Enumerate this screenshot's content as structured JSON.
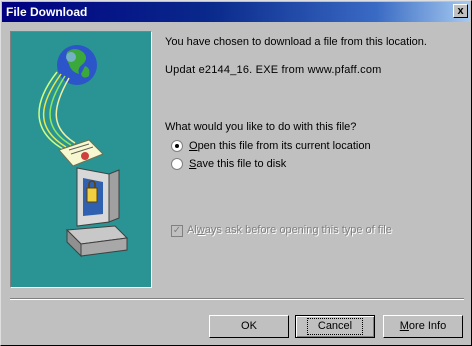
{
  "window": {
    "title": "File Download",
    "close_glyph": "x"
  },
  "message": {
    "line1": "You have chosen to download a file from this location.",
    "filename": "Updat e2144_16. EXE from www.pfaff.com",
    "question": "What would you like to do with this file?"
  },
  "options": {
    "open": {
      "accel": "O",
      "rest": "pen this file from its current location",
      "selected": true
    },
    "save": {
      "accel": "S",
      "rest": "ave this file to disk",
      "selected": false
    }
  },
  "always_ask": {
    "pre": "Al",
    "accel": "w",
    "rest": "ays ask before opening this type of file",
    "checked": true,
    "disabled": true
  },
  "buttons": {
    "ok": "OK",
    "cancel": "Cancel",
    "more_info_accel": "M",
    "more_info_rest": "ore Info"
  },
  "colors": {
    "illustration_bg": "#2a9494",
    "title_start": "#000080",
    "title_end": "#a6caf0"
  }
}
